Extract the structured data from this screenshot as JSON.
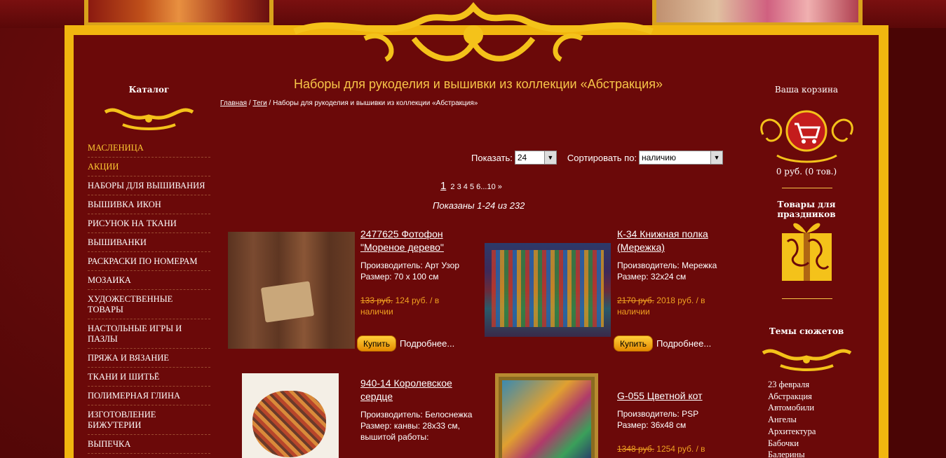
{
  "sidebar": {
    "title": "Каталог",
    "items": [
      {
        "label": "МАСЛЕНИЦА",
        "highlight": true
      },
      {
        "label": "АКЦИИ",
        "highlight": true
      },
      {
        "label": "НАБОРЫ ДЛЯ ВЫШИВАНИЯ",
        "highlight": false
      },
      {
        "label": "ВЫШИВКА ИКОН",
        "highlight": false
      },
      {
        "label": "РИСУНОК НА ТКАНИ",
        "highlight": false
      },
      {
        "label": "ВЫШИВАНКИ",
        "highlight": false
      },
      {
        "label": "РАСКРАСКИ ПО НОМЕРАМ",
        "highlight": false
      },
      {
        "label": "МОЗАИКА",
        "highlight": false
      },
      {
        "label": "ХУДОЖЕСТВЕННЫЕ ТОВАРЫ",
        "highlight": false
      },
      {
        "label": "НАСТОЛЬНЫЕ ИГРЫ И ПАЗЛЫ",
        "highlight": false
      },
      {
        "label": "ПРЯЖА И ВЯЗАНИЕ",
        "highlight": false
      },
      {
        "label": "ТКАНИ И ШИТЬЁ",
        "highlight": false
      },
      {
        "label": "ПОЛИМЕРНАЯ ГЛИНА",
        "highlight": false
      },
      {
        "label": "ИЗГОТОВЛЕНИЕ БИЖУТЕРИИ",
        "highlight": false
      },
      {
        "label": "ВЫПЕЧКА",
        "highlight": false
      }
    ]
  },
  "main": {
    "title": "Наборы для рукоделия и вышивки из коллекции «Абстракция»",
    "breadcrumb": {
      "home": "Главная",
      "sep1": "/",
      "tags": "Теги",
      "sep2": "/",
      "current": "Наборы для рукоделия и вышивки из коллекции «Абстракция»"
    },
    "show_label": "Показать:",
    "show_value": "24",
    "sort_label": "Сортировать по:",
    "sort_value": "наличию",
    "pager": {
      "current": "1",
      "pages": [
        "2",
        "3",
        "4",
        "5",
        "6"
      ],
      "ellipsis": "...",
      "last": "10",
      "next": "»"
    },
    "shown_text": "Показаны 1-24 из 232",
    "products": [
      {
        "title": "2477625 Фотофон \"Мореное дерево\"",
        "maker": "Производитель: Арт Узор",
        "size": "Размер: 70 х 100 см",
        "old_price": "133 руб.",
        "price": "124 руб. / в наличии",
        "buy": "Купить",
        "more": "Подробнее..."
      },
      {
        "title": "К-34 Книжная полка (Мережка)",
        "maker": "Производитель: Мережка",
        "size": "Размер: 32х24 см",
        "old_price": "2170 руб.",
        "price": "2018 руб. / в наличии",
        "buy": "Купить",
        "more": "Подробнее..."
      },
      {
        "title": "940-14 Королевское сердце",
        "maker": "Производитель: Белоснежка",
        "size": "Размер: канвы: 28х33 см, вышитой работы:"
      },
      {
        "title": "G-055 Цветной кот",
        "maker": "Производитель: PSP",
        "size": "Размер: 36х48 см",
        "old_price": "1348 руб.",
        "price": "1254 руб. / в"
      }
    ]
  },
  "right": {
    "cart_title": "Ваша корзина",
    "cart_info": "0 руб.   (0 тов.)",
    "holiday_title": "Товары для праздников",
    "themes_title": "Темы сюжетов",
    "themes": [
      "23 февраля",
      "Абстракция",
      "Автомобили",
      "Ангелы",
      "Архитектура",
      "Бабочки",
      "Балерины"
    ]
  },
  "colors": {
    "frame": "#f1b60f",
    "background": "#6b0909",
    "accent_text": "#f7c548",
    "price": "#f0a020"
  }
}
